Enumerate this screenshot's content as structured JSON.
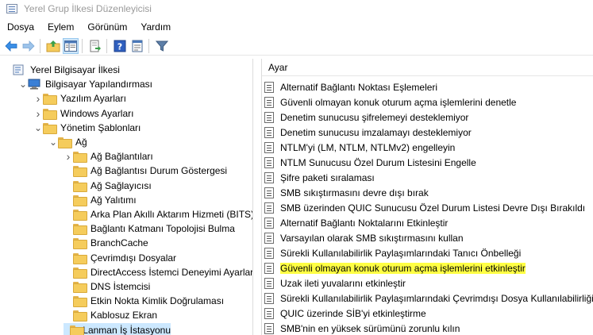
{
  "window": {
    "title": "Yerel Grup İlkesi Düzenleyicisi"
  },
  "menu": [
    "Dosya",
    "Eylem",
    "Görünüm",
    "Yardım"
  ],
  "toolbar": {
    "buttons": [
      "back-arrow-icon",
      "forward-arrow-icon",
      "up-folder-icon",
      "show-hide-tree-icon",
      "export-list-icon",
      "help-icon",
      "properties-icon",
      "filter-icon"
    ]
  },
  "tree": [
    {
      "label": "Yerel Bilgisayar İlkesi",
      "level": 0,
      "chevron": "",
      "icon": "policy"
    },
    {
      "label": "Bilgisayar Yapılandırması",
      "level": 1,
      "chevron": "down",
      "icon": "computer"
    },
    {
      "label": "Yazılım Ayarları",
      "level": 2,
      "chevron": "right",
      "icon": "folder"
    },
    {
      "label": "Windows Ayarları",
      "level": 2,
      "chevron": "right",
      "icon": "folder"
    },
    {
      "label": "Yönetim Şablonları",
      "level": 2,
      "chevron": "down",
      "icon": "folder"
    },
    {
      "label": "Ağ",
      "level": 3,
      "chevron": "down",
      "icon": "folder"
    },
    {
      "label": "Ağ Bağlantıları",
      "level": 4,
      "chevron": "right",
      "icon": "folder"
    },
    {
      "label": "Ağ Bağlantısı Durum Göstergesi",
      "level": 4,
      "chevron": "",
      "icon": "folder"
    },
    {
      "label": "Ağ Sağlayıcısı",
      "level": 4,
      "chevron": "",
      "icon": "folder"
    },
    {
      "label": "Ağ Yalıtımı",
      "level": 4,
      "chevron": "",
      "icon": "folder"
    },
    {
      "label": "Arka Plan Akıllı Aktarım Hizmeti (BITS)",
      "level": 4,
      "chevron": "",
      "icon": "folder"
    },
    {
      "label": "Bağlantı Katmanı Topolojisi Bulma",
      "level": 4,
      "chevron": "",
      "icon": "folder"
    },
    {
      "label": "BranchCache",
      "level": 4,
      "chevron": "",
      "icon": "folder"
    },
    {
      "label": "Çevrimdışı Dosyalar",
      "level": 4,
      "chevron": "",
      "icon": "folder"
    },
    {
      "label": "DirectAccess İstemci Deneyimi Ayarları",
      "level": 4,
      "chevron": "",
      "icon": "folder"
    },
    {
      "label": "DNS İstemcisi",
      "level": 4,
      "chevron": "",
      "icon": "folder"
    },
    {
      "label": "Etkin Nokta Kimlik Doğrulaması",
      "level": 4,
      "chevron": "",
      "icon": "folder"
    },
    {
      "label": "Kablosuz Ekran",
      "level": 4,
      "chevron": "",
      "icon": "folder"
    },
    {
      "label": "Lanman İş İstasyonu",
      "level": 4,
      "chevron": "",
      "icon": "folder",
      "selected": true
    }
  ],
  "settings": {
    "column_header": "Ayar",
    "highlight_color": "#ffff44",
    "items": [
      {
        "label": "Alternatif Bağlantı Noktası Eşlemeleri"
      },
      {
        "label": "Güvenli olmayan konuk oturum açma işlemlerini denetle"
      },
      {
        "label": "Denetim sunucusu şifrelemeyi desteklemiyor"
      },
      {
        "label": "Denetim sunucusu imzalamayı desteklemiyor"
      },
      {
        "label": "NTLM'yi (LM, NTLM, NTLMv2) engelleyin"
      },
      {
        "label": "NTLM Sunucusu Özel Durum Listesini Engelle"
      },
      {
        "label": "Şifre paketi sıralaması"
      },
      {
        "label": "SMB sıkıştırmasını devre dışı bırak"
      },
      {
        "label": "SMB üzerinden QUIC Sunucusu Özel Durum Listesi Devre Dışı Bırakıldı"
      },
      {
        "label": "Alternatif Bağlantı Noktalarını Etkinleştir"
      },
      {
        "label": "Varsayılan olarak SMB sıkıştırmasını kullan"
      },
      {
        "label": "Sürekli Kullanılabilirlik Paylaşımlarındaki Tanıcı Önbelleği"
      },
      {
        "label": "Güvenli olmayan konuk oturum açma işlemlerini etkinleştir",
        "highlighted": true
      },
      {
        "label": "Uzak ileti yuvalarını etkinleştir"
      },
      {
        "label": "Sürekli Kullanılabilirlik Paylaşımlarındaki Çevrimdışı Dosya Kullanılabilirliği"
      },
      {
        "label": "QUIC üzerinde SİB'yi etkinleştirme"
      },
      {
        "label": "SMB'nin en yüksek sürümünü zorunlu kılın"
      }
    ]
  }
}
